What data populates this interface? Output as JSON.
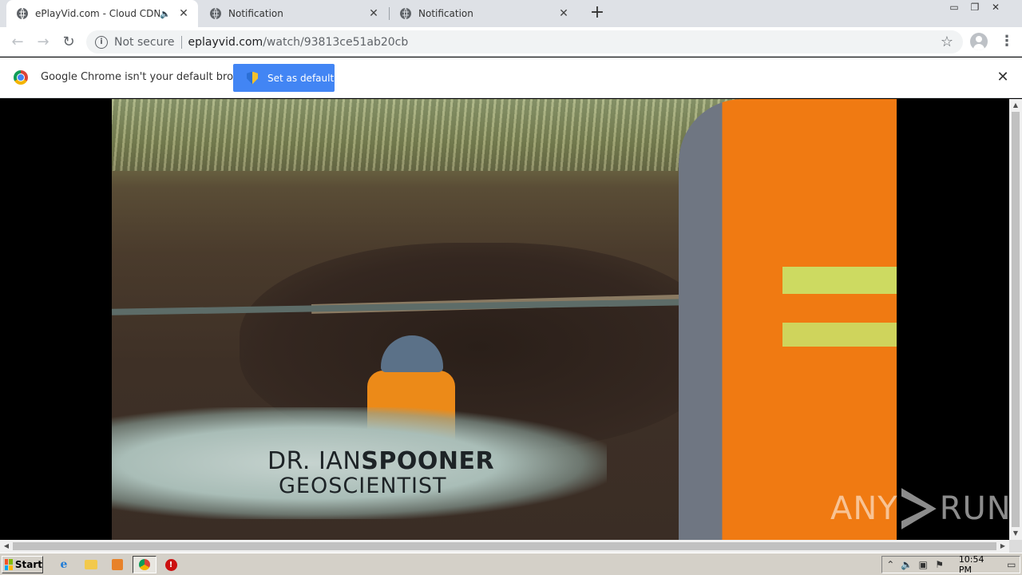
{
  "tabs": [
    {
      "title": "ePlayVid.com - Cloud CDN",
      "active": true,
      "audio": true
    },
    {
      "title": "Notification",
      "active": false
    },
    {
      "title": "Notification",
      "active": false
    }
  ],
  "omnibox": {
    "security": "Not secure",
    "host": "eplayvid.com",
    "path": "/watch/93813ce51ab20cb"
  },
  "infobar": {
    "message": "Google Chrome isn't your default browser",
    "button": "Set as default"
  },
  "video": {
    "name_first": "DR. IAN",
    "name_last": "SPOONER",
    "title": "GEOSCIENTIST"
  },
  "watermark": {
    "left": "ANY",
    "right": "RUN"
  },
  "taskbar": {
    "start": "Start",
    "clock": "10:54 PM"
  },
  "colors": {
    "accent": "#4285f4",
    "vest": "#ec8a18"
  }
}
